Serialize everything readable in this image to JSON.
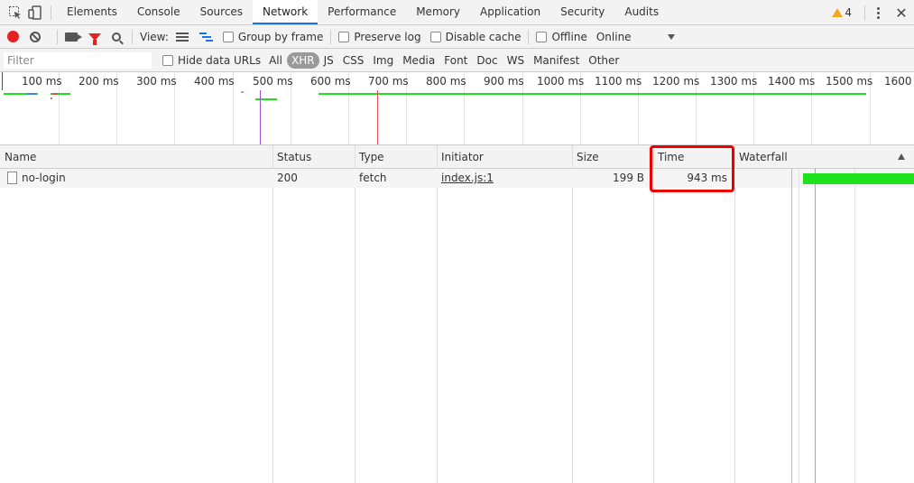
{
  "tabs": [
    "Elements",
    "Console",
    "Sources",
    "Network",
    "Performance",
    "Memory",
    "Application",
    "Security",
    "Audits"
  ],
  "active_tab": "Network",
  "warnings": {
    "count": "4"
  },
  "toolbar": {
    "view_label": "View:",
    "group_by_frame": "Group by frame",
    "preserve_log": "Preserve log",
    "disable_cache": "Disable cache",
    "offline": "Offline",
    "throttle": "Online"
  },
  "filter": {
    "placeholder": "Filter",
    "hide_data_urls": "Hide data URLs",
    "types": [
      "All",
      "XHR",
      "JS",
      "CSS",
      "Img",
      "Media",
      "Font",
      "Doc",
      "WS",
      "Manifest",
      "Other"
    ],
    "active_type": "XHR"
  },
  "overview": {
    "ticks": [
      "100 ms",
      "200 ms",
      "300 ms",
      "400 ms",
      "500 ms",
      "600 ms",
      "700 ms",
      "800 ms",
      "900 ms",
      "1000 ms",
      "1100 ms",
      "1200 ms",
      "1300 ms",
      "1400 ms",
      "1500 ms",
      "1600 ms"
    ]
  },
  "table": {
    "columns": [
      "Name",
      "Status",
      "Type",
      "Initiator",
      "Size",
      "Time",
      "Waterfall"
    ],
    "rows": [
      {
        "name": "no-login",
        "status": "200",
        "type": "fetch",
        "initiator": "index.js:1",
        "size": "199 B",
        "time": "943 ms"
      }
    ]
  },
  "colors": {
    "accent": "#1a73e8",
    "record": "#e52222",
    "highlight": "#e00000",
    "waterfall_bar": "#1be21b"
  }
}
